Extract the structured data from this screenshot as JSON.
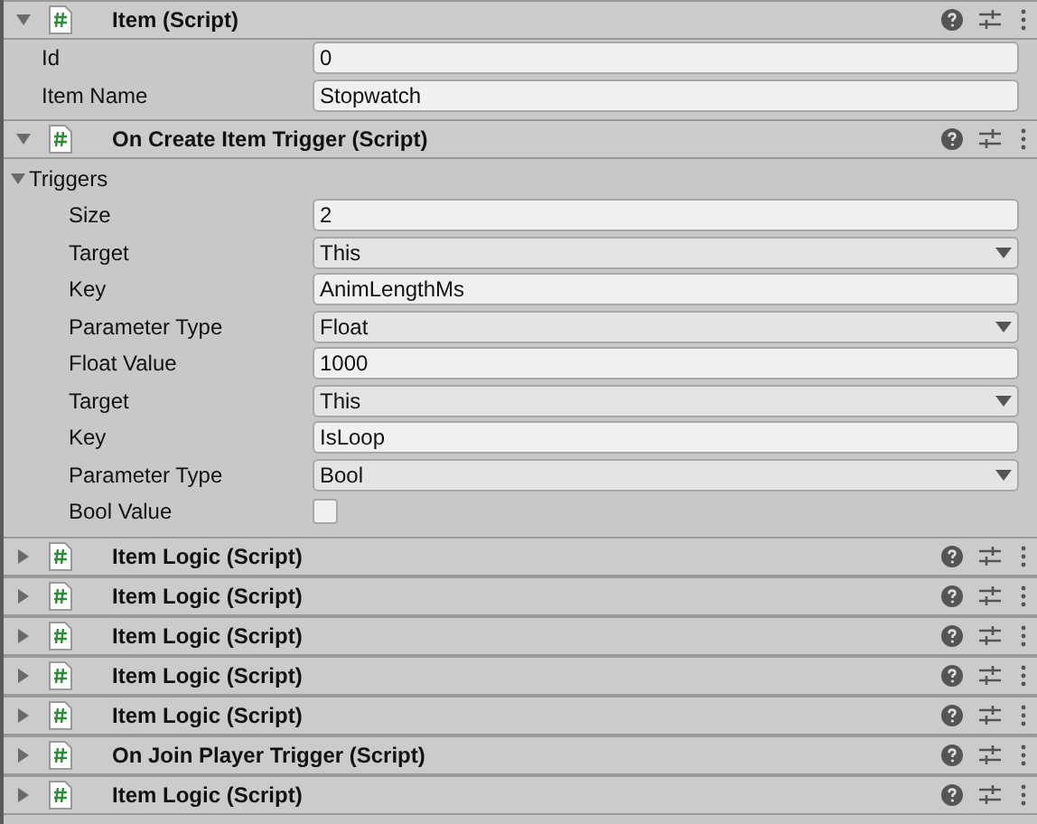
{
  "components": [
    {
      "title": "Item (Script)",
      "expanded": true,
      "fields": [
        {
          "kind": "text",
          "label": "Id",
          "value": "0"
        },
        {
          "kind": "text",
          "label": "Item Name",
          "value": "Stopwatch"
        }
      ]
    },
    {
      "title": "On Create Item Trigger (Script)",
      "expanded": true,
      "fields": [
        {
          "kind": "foldout",
          "label": "Triggers",
          "expanded": true,
          "children": [
            {
              "kind": "text",
              "label": "Size",
              "value": "2"
            },
            {
              "kind": "dropdown",
              "label": "Target",
              "value": "This"
            },
            {
              "kind": "text",
              "label": "Key",
              "value": "AnimLengthMs"
            },
            {
              "kind": "dropdown",
              "label": "Parameter Type",
              "value": "Float"
            },
            {
              "kind": "text",
              "label": "Float Value",
              "value": "1000"
            },
            {
              "kind": "dropdown",
              "label": "Target",
              "value": "This"
            },
            {
              "kind": "text",
              "label": "Key",
              "value": "IsLoop"
            },
            {
              "kind": "dropdown",
              "label": "Parameter Type",
              "value": "Bool"
            },
            {
              "kind": "checkbox",
              "label": "Bool Value",
              "checked": false
            }
          ]
        }
      ]
    },
    {
      "title": "Item Logic (Script)",
      "expanded": false
    },
    {
      "title": "Item Logic (Script)",
      "expanded": false
    },
    {
      "title": "Item Logic (Script)",
      "expanded": false
    },
    {
      "title": "Item Logic (Script)",
      "expanded": false
    },
    {
      "title": "Item Logic (Script)",
      "expanded": false
    },
    {
      "title": "On Join Player Trigger (Script)",
      "expanded": false
    },
    {
      "title": "Item Logic (Script)",
      "expanded": false
    }
  ]
}
